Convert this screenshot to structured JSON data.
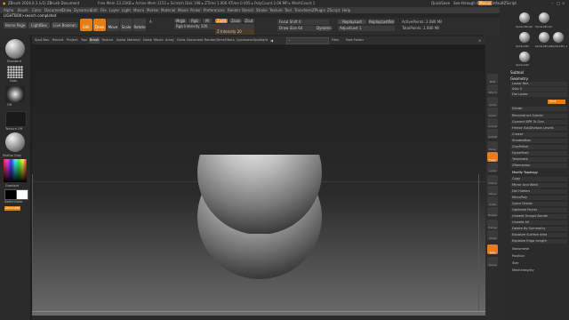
{
  "window": {
    "title": "ZBrush 2024.0.1 (v1) ZBrush Document",
    "stats": "Free Mem 23.21KB ▸ Active Mem 1151 ▸ Scratch Disk 198 ▸ ZTime 1.006 ATime 0.005 ▸ PolyCount 2.08 MP ▸ MeshCount 1",
    "quicksave": "QuickSave",
    "seethrough": "See-through  0",
    "menus_label": "Menus",
    "script": "DefaultZScript"
  },
  "menubar": [
    "Alpha",
    "Brush",
    "Color",
    "Document",
    "Draw",
    "Dynamics",
    "Edit",
    "File",
    "Layer",
    "Light",
    "Macro",
    "Marker",
    "Material",
    "Movie",
    "Picker",
    "Preferences",
    "Render",
    "Stencil",
    "Stroke",
    "Texture",
    "Tool",
    "Transform",
    "ZPlugin",
    "ZScript",
    "Help"
  ],
  "notify": "LIGHTBOX>search completed",
  "topshelf": {
    "home": "Home Page",
    "lightbox": "LightBox",
    "liveboolean": "Live Boolean",
    "edit": "Edit",
    "draw": "Draw",
    "move": "Move",
    "scale": "Scale",
    "rotate": "Rotate",
    "a_label": "A",
    "mrgb": "Mrgb",
    "rgb": "Rgb",
    "m": "M",
    "zadd": "Zadd",
    "zsub": "Zsub",
    "zcut": "Zcut",
    "rgb_intensity": "Rgb Intensity 100",
    "z_intensity": "Z Intensity 20",
    "focal_shift": "Focal Shift 0",
    "draw_size": "Draw Size 64",
    "dynamic": "Dynamic",
    "replay_last": "ReplayLast",
    "replay_last_rel": "ReplayLastRel",
    "active_points": "ActivePoints: 2.080 Mil",
    "total_points": "TotalPoints: 2.080 Mil",
    "adjust": "AdjustLast 1"
  },
  "left": {
    "brush": "Standard",
    "stroke": "Dots",
    "alpha": "Off",
    "texture": "Texture Off",
    "material": "MatCap Gray",
    "gradient": "Gradient",
    "switch": "SwitchColor",
    "alternate": "Alternate"
  },
  "tabs": [
    "Spot Nav",
    "Recent",
    "Project",
    "Tool",
    "Brush",
    "Texture",
    "Alpha",
    "Material",
    "Noise",
    "Movie",
    "Array",
    "Grids",
    "Document",
    "Render/Sims",
    "Filters",
    "Quicksave",
    "Spotlight"
  ],
  "tabs_right": [
    "Files",
    "New Folder"
  ],
  "rightbar": [
    "BPR",
    "SPix 3",
    "Scroll",
    "Zoom",
    "Actual",
    "AAHalf",
    "Persp",
    "Floor",
    "Local",
    "Frame",
    "Move",
    "Scale",
    "Rotate",
    "Transp",
    "Ghost",
    "Solo",
    "Xpose"
  ],
  "rpanel": {
    "subtool": "Subtool",
    "geometry": "Geometry",
    "rows": [
      "Lower Res",
      "Sdiv 5",
      "Del Lower",
      "Smt",
      "Divide",
      "Reconstruct Subdiv",
      "Convert BPR To Geo",
      "Freeze SubDivision Levels",
      "Crease",
      "ShadowBox",
      "ClayPolish",
      "DynaMesh",
      "Tessimate",
      "ZRemesher",
      "Modify Topology",
      "Copy",
      "Mirror And Weld",
      "Del Hidden",
      "MicroPoly",
      "Quick Divide",
      "Optimize Points",
      "Unweld Groups Border",
      "Unweld All",
      "Delete By Symmetry",
      "Equalize Surface Area",
      "Equalize Edge Length",
      "Nanomesh",
      "Position",
      "Size",
      "MeshIntegrity"
    ],
    "balls": [
      "SphereBrush",
      "SphereBrush",
      "Sphere3D",
      "SphereBrush",
      "Sphere3D_1",
      "Sphere3D"
    ]
  }
}
